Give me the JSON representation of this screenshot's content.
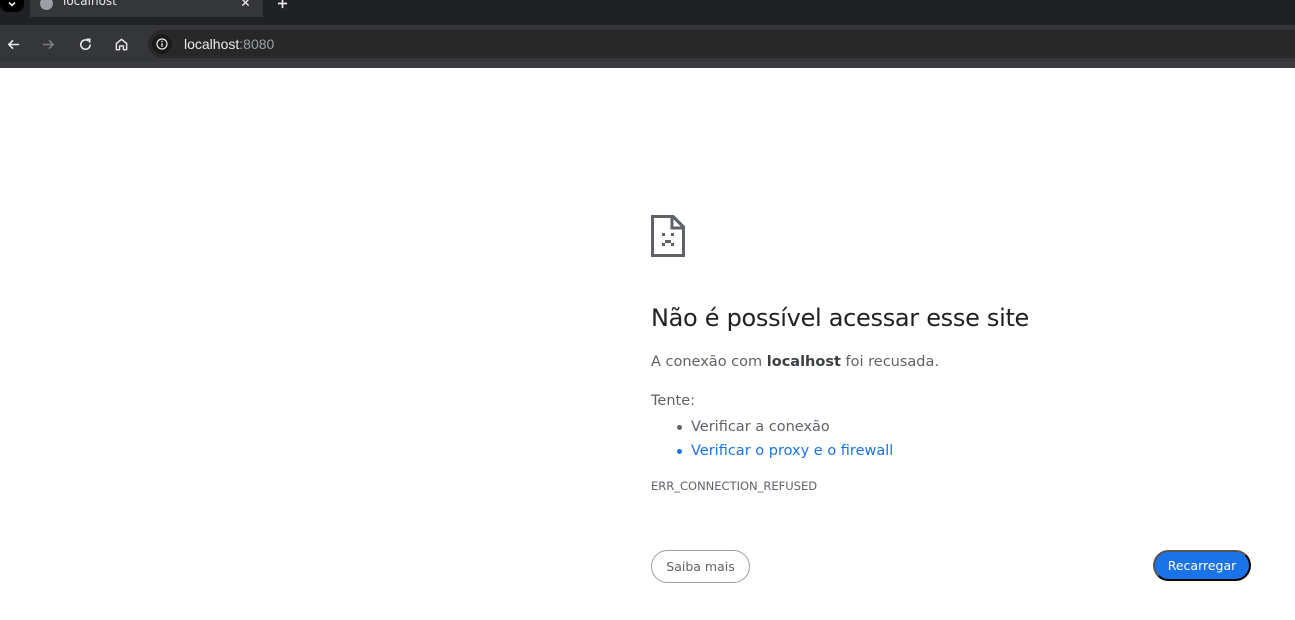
{
  "browser": {
    "tab": {
      "title": "localhost",
      "favicon": "globe-icon",
      "close_icon": "close-icon"
    },
    "new_tab_icon": "plus-icon",
    "tab_search_icon": "chevron-down-icon",
    "toolbar": {
      "back_icon": "arrow-left-icon",
      "forward_icon": "arrow-right-icon",
      "reload_icon": "reload-icon",
      "home_icon": "home-icon",
      "site_info_icon": "info-icon"
    },
    "url": {
      "host": "localhost",
      "port": ":8080"
    }
  },
  "error_page": {
    "icon": "sad-document-icon",
    "title": "Não é possível acessar esse site",
    "description_prefix": "A conexão com ",
    "description_host": "localhost",
    "description_suffix": " foi recusada.",
    "try_label": "Tente:",
    "suggestions": [
      "Verificar a conexão",
      "Verificar o proxy e o firewall"
    ],
    "error_code": "ERR_CONNECTION_REFUSED",
    "details_button": "Saiba mais",
    "reload_button": "Recarregar"
  },
  "colors": {
    "accent": "#1a73e8",
    "toolbar_bg": "#35363a",
    "tabstrip_bg": "#202124",
    "text_primary": "#202124",
    "text_secondary": "#5f6368"
  }
}
